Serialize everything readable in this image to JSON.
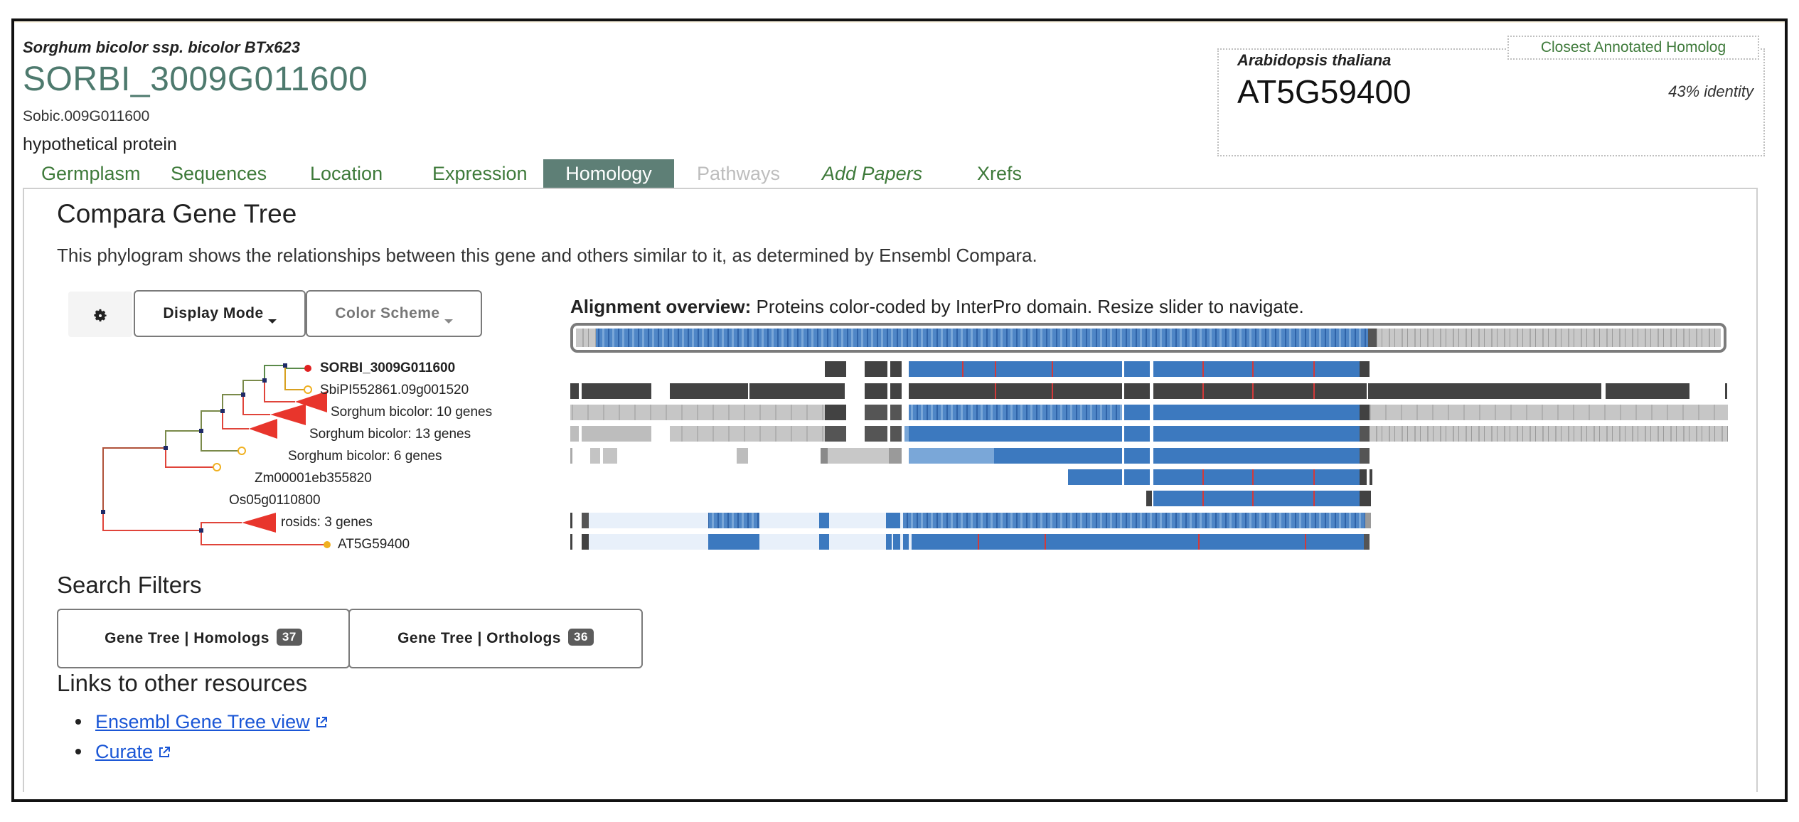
{
  "header": {
    "species": "Sorghum bicolor ssp. bicolor BTx623",
    "gene_id": "SORBI_3009G011600",
    "alt_id": "Sobic.009G011600",
    "description": "hypothetical protein"
  },
  "closest_homolog": {
    "tag": "Closest Annotated Homolog",
    "species": "Arabidopsis thaliana",
    "gene_id": "AT5G59400",
    "identity": "43% identity"
  },
  "tabs": [
    {
      "label": "Germplasm",
      "state": "normal"
    },
    {
      "label": "Sequences",
      "state": "normal"
    },
    {
      "label": "Location",
      "state": "normal"
    },
    {
      "label": "Expression",
      "state": "normal"
    },
    {
      "label": "Homology",
      "state": "active"
    },
    {
      "label": "Pathways",
      "state": "disabled"
    },
    {
      "label": "Add Papers",
      "state": "italic"
    },
    {
      "label": "Xrefs",
      "state": "normal"
    }
  ],
  "section": {
    "title": "Compara Gene Tree",
    "description": "This phylogram shows the relationships between this gene and others similar to it, as determined by Ensembl Compara."
  },
  "controls": {
    "gear_icon": "gear-icon",
    "display_mode": "Display Mode",
    "color_scheme": "Color Scheme"
  },
  "tree": {
    "leaves": [
      {
        "label": "SORBI_3009G011600",
        "kind": "gene",
        "bold": true
      },
      {
        "label": "SbiPI552861.09g001520",
        "kind": "gene"
      },
      {
        "label": "Sorghum bicolor: 10 genes",
        "kind": "collapsed"
      },
      {
        "label": "Sorghum bicolor: 13 genes",
        "kind": "collapsed"
      },
      {
        "label": "Sorghum bicolor: 6 genes",
        "kind": "collapsed"
      },
      {
        "label": "Zm00001eb355820",
        "kind": "gene"
      },
      {
        "label": "Os05g0110800",
        "kind": "gene"
      },
      {
        "label": "rosids: 3 genes",
        "kind": "collapsed"
      },
      {
        "label": "AT5G59400",
        "kind": "gene"
      }
    ],
    "colors": {
      "branch_red": "#e0443a",
      "branch_green": "#5a8a4a",
      "node": "#1f2a66",
      "collapsed": "#e8352c",
      "leaf_open": "#f0b020",
      "focus": "#e02020"
    }
  },
  "alignment": {
    "title_bold": "Alignment overview:",
    "title_rest": " Proteins color-coded by InterPro domain. Resize slider to navigate.",
    "colors": {
      "domain": "#3c79bf",
      "domain_light": "#7aa7d8",
      "dark": "#424242",
      "mid": "#8a8a8a",
      "light": "#c8c8c8",
      "pale_blue": "#e8f0fa",
      "mark": "#d23a3a"
    }
  },
  "filters": {
    "title": "Search Filters",
    "homologs_label": "Gene Tree | Homologs",
    "homologs_count": "37",
    "orthologs_label": "Gene Tree | Orthologs",
    "orthologs_count": "36"
  },
  "links": {
    "title": "Links to other resources",
    "items": [
      "Ensembl Gene Tree view",
      "Curate"
    ]
  }
}
